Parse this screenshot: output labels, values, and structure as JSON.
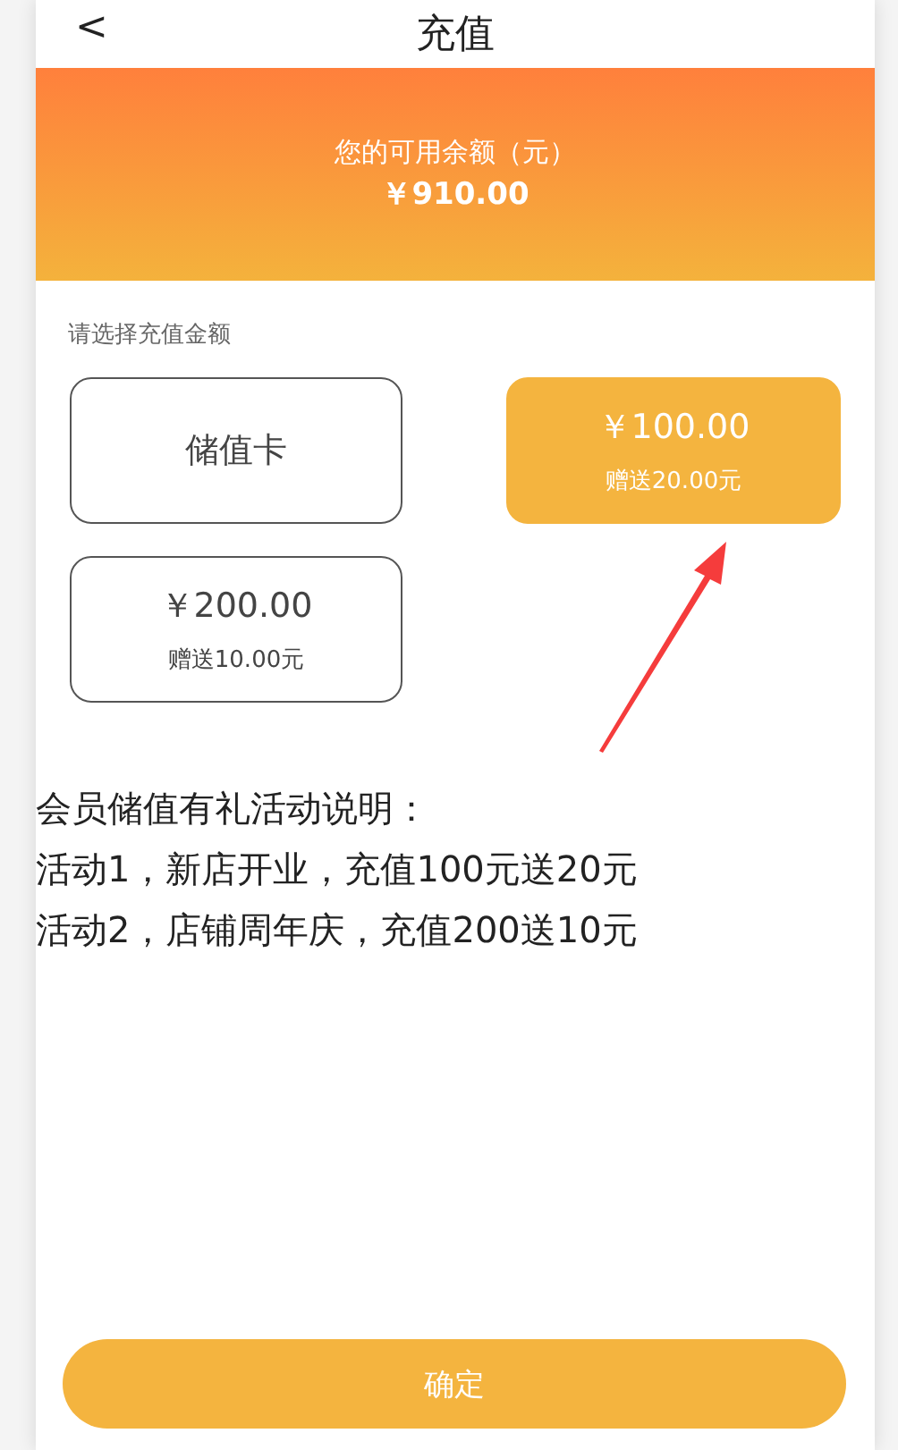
{
  "header": {
    "back": "<",
    "title": "充值"
  },
  "balance": {
    "label": "您的可用余额（元）",
    "amount": "￥910.00"
  },
  "options_label": "请选择充值金额",
  "options": [
    {
      "title": "储值卡",
      "selected": false
    },
    {
      "title": "￥100.00",
      "bonus": "赠送20.00元",
      "selected": true
    },
    {
      "title": "￥200.00",
      "bonus": "赠送10.00元",
      "selected": false
    }
  ],
  "notes": [
    "会员储值有礼活动说明：",
    "活动1，新店开业，充值100元送20元",
    "活动2，店铺周年庆，充值200送10元"
  ],
  "confirm_button": "确定"
}
